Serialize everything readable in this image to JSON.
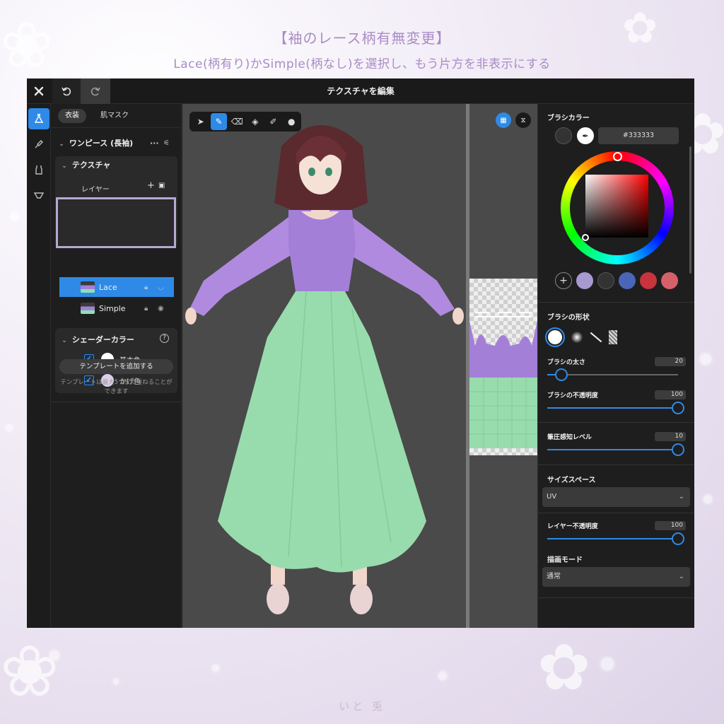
{
  "banner": {
    "title": "【袖のレース柄有無変更】",
    "subtitle": "Lace(柄有り)かSimple(柄なし)を選択し、もう片方を非表示にする",
    "credit": "いと 兎"
  },
  "topbar": {
    "close_icon": "close-icon",
    "undo_icon": "undo-icon",
    "redo_icon": "redo-icon",
    "title": "テクスチャを編集"
  },
  "rail": [
    "flask-icon",
    "brush-icon",
    "tank-top-icon",
    "underwear-icon"
  ],
  "left": {
    "tabs": [
      {
        "label": "衣装",
        "active": true
      },
      {
        "label": "肌マスク",
        "active": false
      }
    ],
    "item_title": "ワンピース (長袖)",
    "texture_section": "テクスチャ",
    "layer_header": "レイヤー",
    "layers": [
      {
        "name": "Lace",
        "selected": true
      },
      {
        "name": "Simple",
        "selected": false
      }
    ],
    "shader_section": "シェーダーカラー",
    "shader_colors": [
      {
        "label": "基本色",
        "color": "#ffffff",
        "checked": true
      },
      {
        "label": "かげ色",
        "color": "#dccde9",
        "checked": true
      }
    ],
    "add_template": "テンプレートを追加する",
    "template_note": "テンプレートは最大5つまで重ねることができます"
  },
  "viewport": {
    "tools": [
      "cursor-icon",
      "pen-icon",
      "eraser-icon",
      "fill-icon",
      "smudge-icon",
      "drop-icon"
    ],
    "active_tool": "pen-icon"
  },
  "uv": {
    "buttons": [
      "grid-icon",
      "mirror-icon"
    ]
  },
  "right": {
    "brush_color_label": "ブラシカラー",
    "hex": "#333333",
    "current_color": "#333333",
    "palette": [
      "#a79ad0",
      "#333333",
      "#4a66b8",
      "#c8343c",
      "#d6606a"
    ],
    "brush_shape_label": "ブラシの形状",
    "sliders": [
      {
        "label": "ブラシの太さ",
        "value": "20",
        "fraction": 0.11
      },
      {
        "label": "ブラシの不透明度",
        "value": "100",
        "fraction": 1.0
      },
      {
        "label": "筆圧感知レベル",
        "value": "10",
        "fraction": 1.0
      }
    ],
    "size_space_label": "サイズスペース",
    "size_space_value": "UV",
    "layer_opacity_label": "レイヤー不透明度",
    "layer_opacity_value": "100",
    "layer_opacity_fraction": 1.0,
    "draw_mode_label": "描画モード",
    "draw_mode_value": "通常"
  }
}
